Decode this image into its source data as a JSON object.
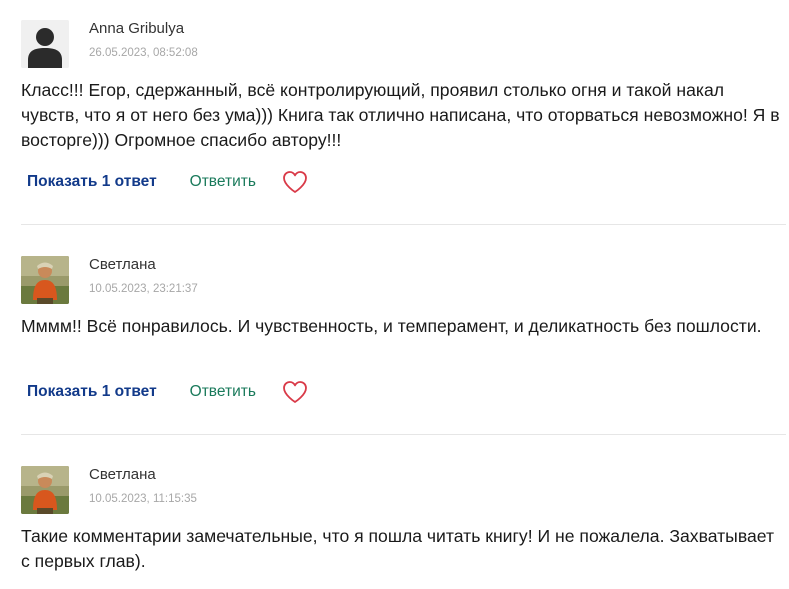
{
  "comments": [
    {
      "author": "Anna Gribulya",
      "date": "26.05.2023, 08:52:08",
      "avatar": "default-user-icon",
      "text": "Класс!!! Егор, сдержанный, всё контролирующий, проявил столько огня и такой накал чувств, что я от него без ума))) Книга так отлично написана, что оторваться невозможно! Я в восторге))) Огромное спасибо автору!!!",
      "show_replies_label": "Показать 1 ответ",
      "reply_label": "Ответить"
    },
    {
      "author": "Светлана",
      "date": "10.05.2023, 23:21:37",
      "avatar": "user-photo",
      "text": "Мммм!! Всё понравилось. И чувственность, и темперамент, и деликатность без пошлости.",
      "show_replies_label": "Показать 1 ответ",
      "reply_label": "Ответить"
    },
    {
      "author": "Светлана",
      "date": "10.05.2023, 11:15:35",
      "avatar": "user-photo",
      "text": "Такие комментарии замечательные, что я пошла читать книгу! И не пожалела. Захватывает с первых глав)."
    }
  ],
  "colors": {
    "show_replies": "#123a8a",
    "reply": "#1a7a5b",
    "heart": "#d93a48",
    "date": "#a7a7a7",
    "divider": "#e6e6e6"
  }
}
